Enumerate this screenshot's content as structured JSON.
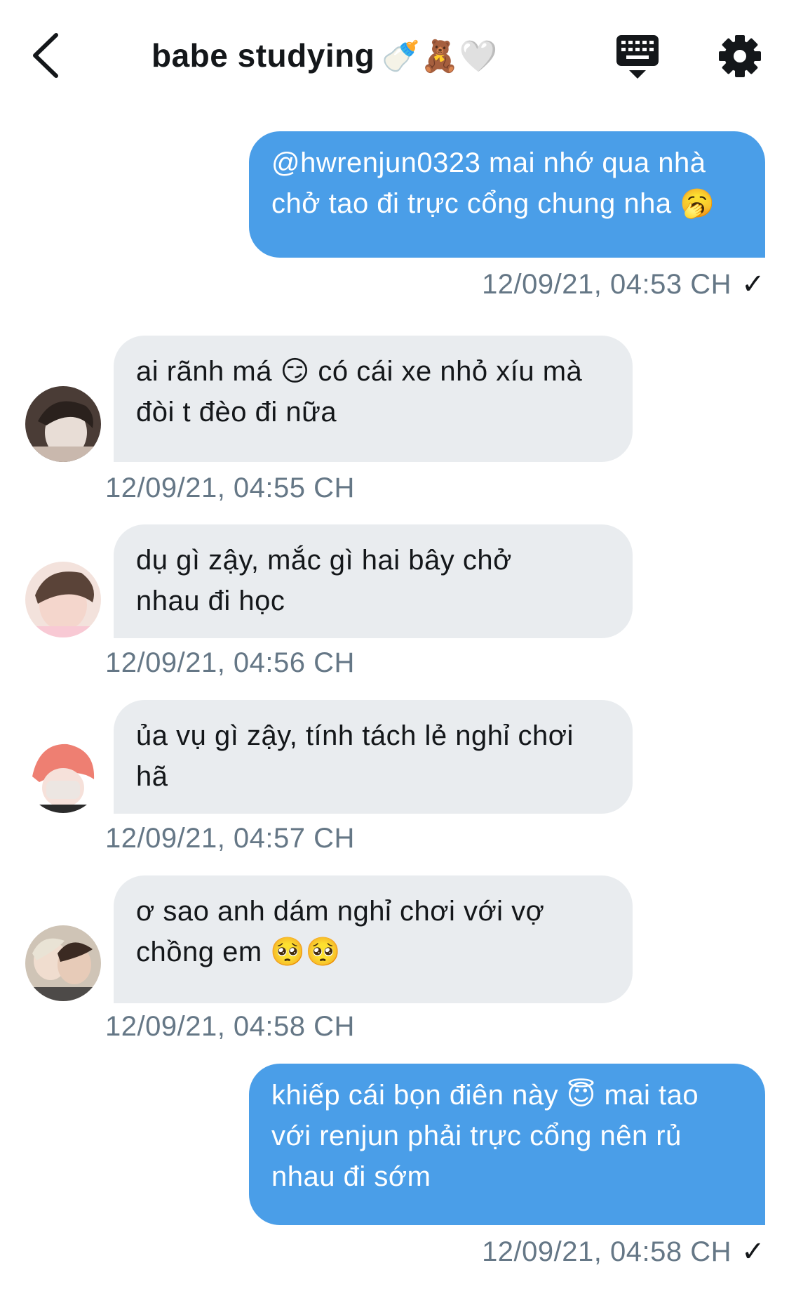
{
  "header": {
    "title": "babe studying",
    "title_emojis": "🍼🧸🤍",
    "back_icon": "chevron-left-icon",
    "keyboard_icon": "keyboard-icon",
    "settings_icon": "gear-icon"
  },
  "colors": {
    "outgoing_bubble": "#4a9ee8",
    "incoming_bubble": "#e9ecef",
    "timestamp": "#657786"
  },
  "messages": [
    {
      "direction": "outgoing",
      "lines": [
        "@hwrenjun0323 mai nhớ qua nhà",
        "chở tao đi trực cổng chung nha 🥱"
      ],
      "timestamp": "12/09/21, 04:53 CH",
      "status": "✓"
    },
    {
      "direction": "incoming",
      "lines": [
        "ai rãnh má 😏 có cái xe nhỏ xíu mà",
        "đòi t đèo đi nữa"
      ],
      "timestamp": "12/09/21, 04:55 CH"
    },
    {
      "direction": "incoming",
      "lines": [
        "dụ gì zậy, mắc gì hai bây chở",
        "nhau đi học"
      ],
      "timestamp": "12/09/21, 04:56 CH"
    },
    {
      "direction": "incoming",
      "lines": [
        "ủa vụ gì zậy, tính tách lẻ nghỉ chơi",
        "hã"
      ],
      "timestamp": "12/09/21, 04:57 CH"
    },
    {
      "direction": "incoming",
      "lines": [
        "ơ sao anh dám nghỉ chơi với vợ",
        "chồng em 🥺🥺"
      ],
      "timestamp": "12/09/21, 04:58 CH"
    },
    {
      "direction": "outgoing",
      "lines": [
        "khiếp cái bọn điên này 😇 mai tao",
        "với renjun phải trực cổng nên rủ",
        "nhau đi sớm"
      ],
      "timestamp": "12/09/21, 04:58 CH",
      "status": "✓"
    }
  ]
}
